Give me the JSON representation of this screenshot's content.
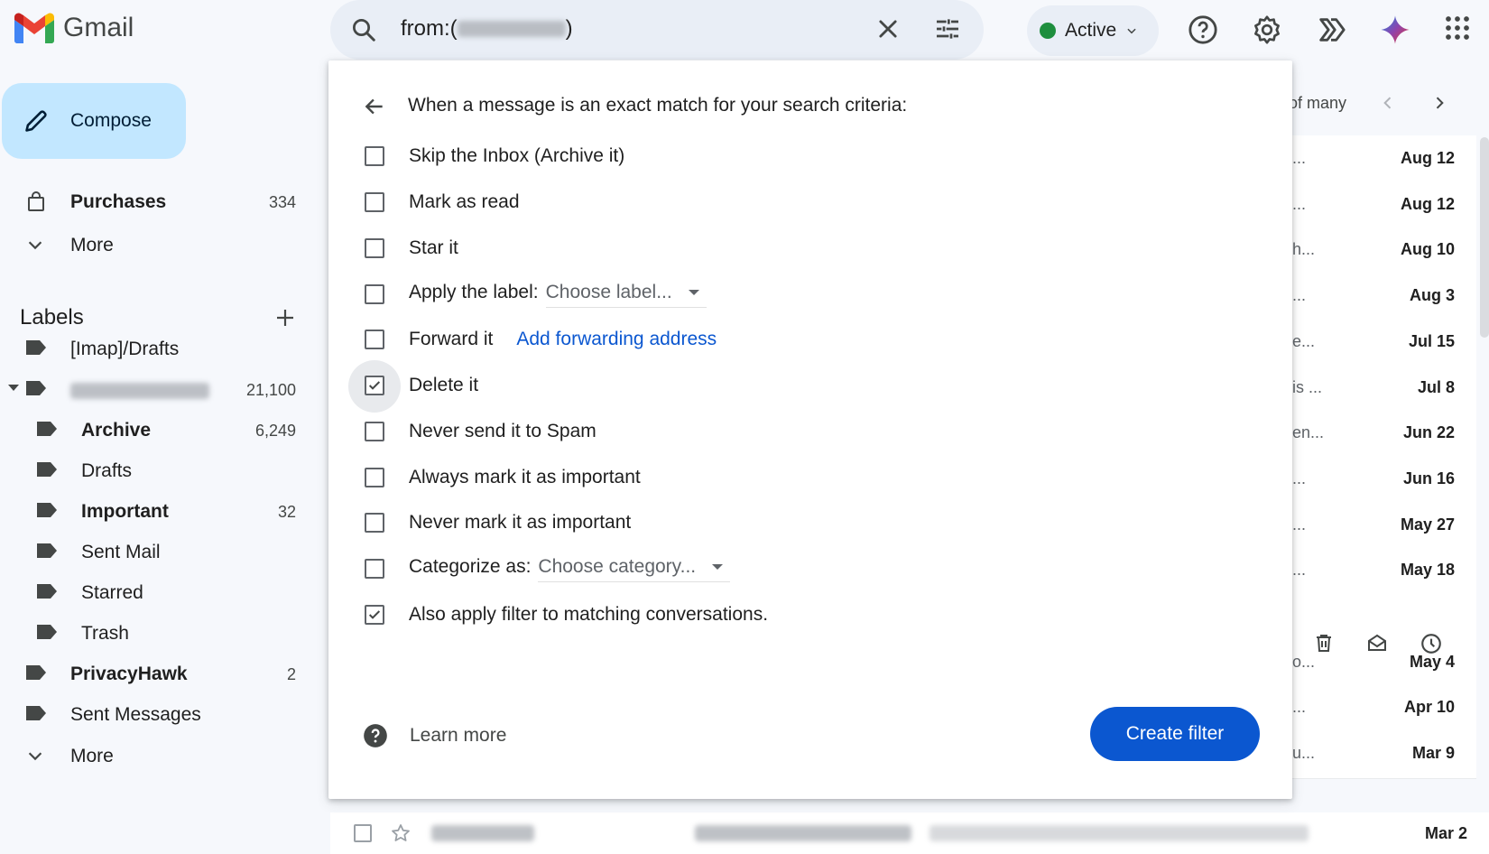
{
  "app": {
    "name": "Gmail"
  },
  "search": {
    "query_prefix": "from:(",
    "query_suffix": ")"
  },
  "status": {
    "label": "Active"
  },
  "sidebar": {
    "compose": "Compose",
    "items": [
      {
        "label": "Purchases",
        "count": "334"
      },
      {
        "label": "More"
      }
    ],
    "labels_title": "Labels",
    "labels": [
      {
        "label": "[Imap]/Drafts",
        "count": ""
      },
      {
        "label": "",
        "count": "21,100"
      },
      {
        "label": "Archive",
        "count": "6,249"
      },
      {
        "label": "Drafts",
        "count": ""
      },
      {
        "label": "Important",
        "count": "32"
      },
      {
        "label": "Sent Mail",
        "count": ""
      },
      {
        "label": "Starred",
        "count": ""
      },
      {
        "label": "Trash",
        "count": ""
      },
      {
        "label": "PrivacyHawk",
        "count": "2"
      },
      {
        "label": "Sent Messages",
        "count": ""
      },
      {
        "label": "More",
        "count": ""
      }
    ]
  },
  "list": {
    "pagination": "of many",
    "rows": [
      {
        "snippet": "...",
        "date": "Aug 12"
      },
      {
        "snippet": "...",
        "date": "Aug 12"
      },
      {
        "snippet": "h...",
        "date": "Aug 10"
      },
      {
        "snippet": "...",
        "date": "Aug 3"
      },
      {
        "snippet": "e...",
        "date": "Jul 15"
      },
      {
        "snippet": "is ...",
        "date": "Jul 8"
      },
      {
        "snippet": "en...",
        "date": "Jun 22"
      },
      {
        "snippet": "...",
        "date": "Jun 16"
      },
      {
        "snippet": "...",
        "date": "May 27"
      },
      {
        "snippet": "...",
        "date": "May 18"
      },
      {
        "snippet": "",
        "date": ""
      },
      {
        "snippet": "o...",
        "date": "May 4"
      },
      {
        "snippet": "...",
        "date": "Apr 10"
      },
      {
        "snippet": "u...",
        "date": "Mar 9"
      }
    ],
    "last_date": "Mar 2"
  },
  "filter": {
    "heading": "When a message is an exact match for your search criteria:",
    "options": [
      {
        "label": "Skip the Inbox (Archive it)",
        "checked": false
      },
      {
        "label": "Mark as read",
        "checked": false
      },
      {
        "label": "Star it",
        "checked": false
      },
      {
        "label": "Apply the label:",
        "checked": false,
        "dropdown": "Choose label..."
      },
      {
        "label": "Forward it",
        "checked": false,
        "link": "Add forwarding address"
      },
      {
        "label": "Delete it",
        "checked": true
      },
      {
        "label": "Never send it to Spam",
        "checked": false
      },
      {
        "label": "Always mark it as important",
        "checked": false
      },
      {
        "label": "Never mark it as important",
        "checked": false
      },
      {
        "label": "Categorize as:",
        "checked": false,
        "dropdown": "Choose category..."
      },
      {
        "label": "Also apply filter to matching conversations.",
        "checked": true
      }
    ],
    "learn_more": "Learn more",
    "create_button": "Create filter"
  },
  "colors": {
    "accent": "#0b57d0",
    "compose_bg": "#c2e7ff",
    "status_green": "#1e8e3e"
  }
}
